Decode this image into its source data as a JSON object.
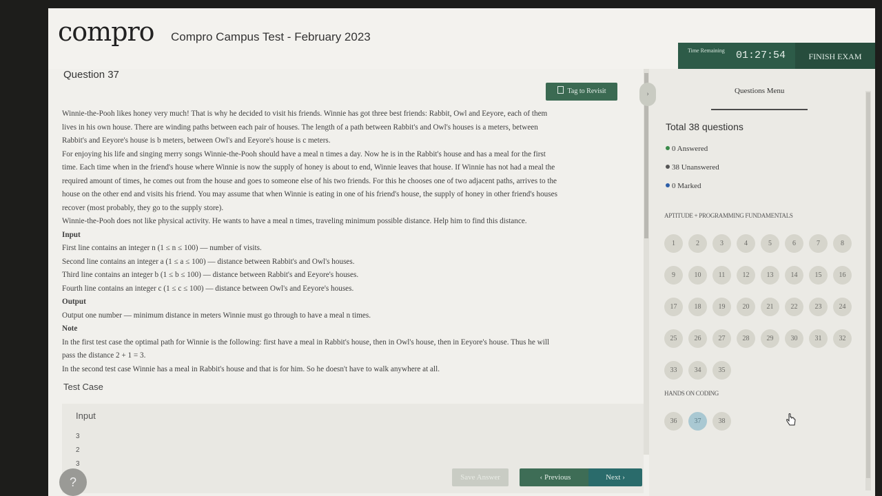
{
  "header": {
    "logo": "compro",
    "title": "Compro Campus Test - February 2023",
    "timer_label": "Time Remaining",
    "timer_value": "01:27:54",
    "finish_label": "FINISH EXAM"
  },
  "question": {
    "number_label": "Question 37",
    "tag_label": "Tag to Revisit",
    "lines": [
      "Winnie-the-Pooh likes honey very much! That is why he decided to visit his friends. Winnie has got three best friends: Rabbit, Owl and Eeyore, each of them",
      "lives in his own house. There are winding paths between each pair of houses. The length of a path between Rabbit's and Owl's houses is a meters, between",
      "Rabbit's and Eeyore's house is b meters, between Owl's and Eeyore's house is c meters.",
      "For enjoying his life and singing merry songs Winnie-the-Pooh should have a meal n times a day. Now he is in the Rabbit's house and has a meal for the first",
      "time. Each time when in the friend's house where Winnie is now the supply of honey is about to end, Winnie leaves that house. If Winnie has not had a meal the",
      "required amount of times, he comes out from the house and goes to someone else of his two friends. For this he chooses one of two adjacent paths, arrives to the",
      "house on the other end and visits his friend. You may assume that when Winnie is eating in one of his friend's house, the supply of honey in other friend's houses",
      "recover (most probably, they go to the supply store).",
      "Winnie-the-Pooh does not like physical activity. He wants to have a meal n times, traveling minimum possible distance. Help him to find this distance."
    ],
    "input_heading": "Input",
    "input_lines": [
      "First line contains an integer n (1 ≤ n ≤ 100) — number of visits.",
      "Second line contains an integer a (1 ≤ a ≤ 100) — distance between Rabbit's and Owl's houses.",
      "Third line contains an integer b (1 ≤ b ≤ 100) — distance between Rabbit's and Eeyore's houses.",
      "Fourth line contains an integer c (1 ≤ c ≤ 100) — distance between Owl's and Eeyore's houses."
    ],
    "output_heading": "Output",
    "output_line": "Output one number — minimum distance in meters Winnie must go through to have a meal n times.",
    "note_heading": "Note",
    "note_lines": [
      "In the first test case the optimal path for Winnie is the following: first have a meal in Rabbit's house, then in Owl's house, then in Eeyore's house. Thus he will",
      "pass the distance 2 + 1 = 3.",
      "In the second test case Winnie has a meal in Rabbit's house and that is for him. So he doesn't have to walk anywhere at all."
    ]
  },
  "testcase": {
    "heading": "Test Case",
    "input_label": "Input",
    "input_values": [
      "3",
      "2",
      "3"
    ]
  },
  "footer": {
    "help": "?",
    "save_label": "Save Answer",
    "prev_label": "Previous",
    "next_label": "Next"
  },
  "sidebar": {
    "menu_title": "Questions Menu",
    "total": "Total 38 questions",
    "answered": "0 Answered",
    "unanswered": "38 Unanswered",
    "marked": "0 Marked",
    "section1": "APTITUDE + PROGRAMMING FUNDAMENTALS",
    "section2": "HANDS ON CODING",
    "current_question": 37,
    "colors": {
      "answered": "#3a8a4a",
      "unanswered": "#555555",
      "marked": "#2e5fa8"
    }
  }
}
